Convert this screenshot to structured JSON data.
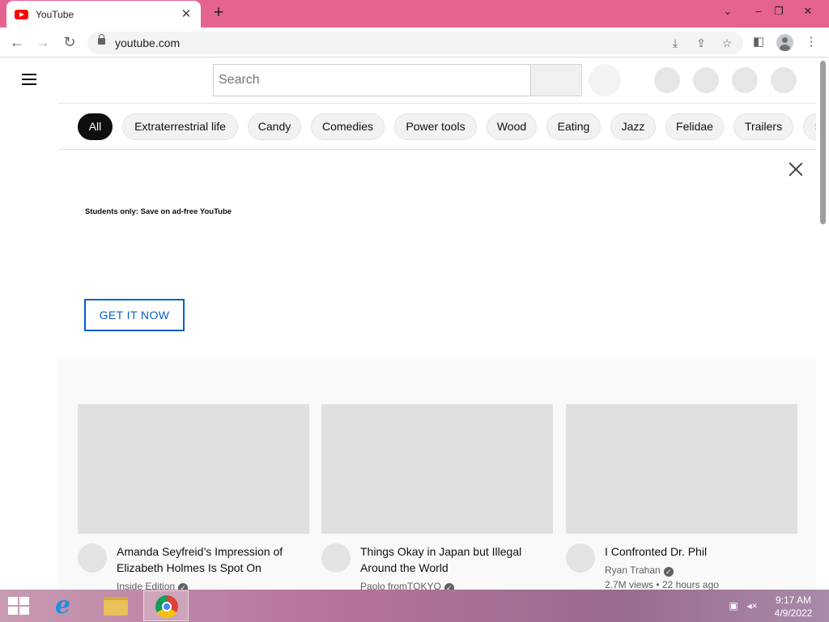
{
  "browser": {
    "tab_title": "YouTube",
    "tab_close": "✕",
    "new_tab": "+",
    "url": "youtube.com",
    "window_controls": {
      "dropdown": "⌄",
      "minimize": "–",
      "restore": "❐",
      "close": "✕"
    }
  },
  "header": {
    "search_placeholder": "Search"
  },
  "chips": [
    "All",
    "Extraterrestrial life",
    "Candy",
    "Comedies",
    "Power tools",
    "Wood",
    "Eating",
    "Jazz",
    "Felidae",
    "Trailers",
    "S"
  ],
  "banner": {
    "text": "Students only: Save on ad-free YouTube",
    "cta": "GET IT NOW"
  },
  "videos": [
    {
      "title": "Amanda Seyfreid’s Impression of Elizabeth Holmes Is Spot On",
      "channel": "Inside Edition",
      "meta": ""
    },
    {
      "title": "Things Okay in Japan but Illegal Around the World",
      "channel": "Paolo fromTOKYO",
      "meta": ""
    },
    {
      "title": "I Confronted Dr. Phil",
      "channel": "Ryan Trahan",
      "meta": "2.7M views • 22 hours ago"
    }
  ],
  "taskbar": {
    "time": "9:17 AM",
    "date": "4/9/2022"
  },
  "colors": {
    "tabstrip": "#e5648f",
    "accent_blue": "#065fd4",
    "chip_active": "#0f0f0f"
  }
}
